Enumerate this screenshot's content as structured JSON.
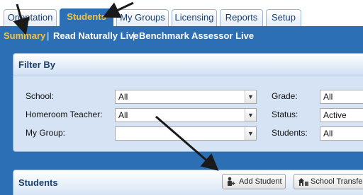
{
  "tabs": [
    {
      "label": "Orientation",
      "active": false
    },
    {
      "label": "Students",
      "active": true
    },
    {
      "label": "My Groups",
      "active": false
    },
    {
      "label": "Licensing",
      "active": false
    },
    {
      "label": "Reports",
      "active": false
    },
    {
      "label": "Setup",
      "active": false
    }
  ],
  "subnav": {
    "items": [
      "Summary",
      "Read Naturally Live",
      "Benchmark Assessor Live"
    ],
    "separator": "|"
  },
  "filter": {
    "title": "Filter By",
    "school_label": "School:",
    "school_value": "All",
    "homeroom_label": "Homeroom Teacher:",
    "homeroom_value": "All",
    "group_label": "My Group:",
    "group_value": "",
    "grade_label": "Grade:",
    "grade_value": "All",
    "status_label": "Status:",
    "status_value": "Active",
    "students_label": "Students:",
    "students_value": "All"
  },
  "students_panel": {
    "title": "Students",
    "add_student_label": "Add Student",
    "school_transfer_label": "School Transfe"
  },
  "colors": {
    "brand_blue": "#2d6fb5",
    "highlight_gold": "#f6c23c",
    "panel_bg": "#d5e3f4"
  },
  "icons": [
    "chevron-down-icon",
    "add-student-icon",
    "school-transfer-icon"
  ]
}
